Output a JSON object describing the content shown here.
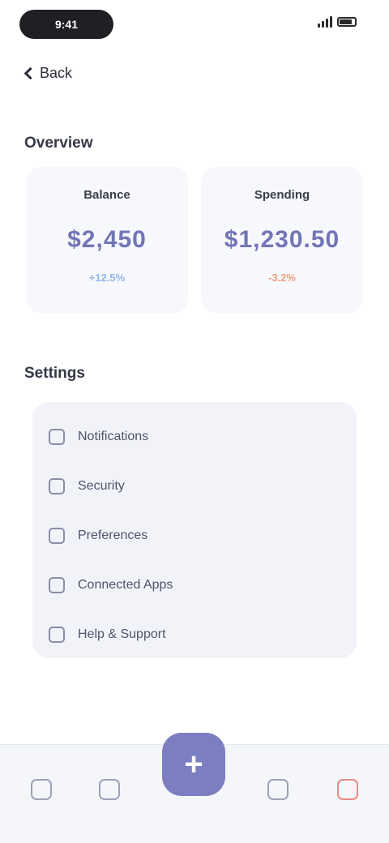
{
  "status_bar": {
    "time": "9:41"
  },
  "header": {
    "back_label": "Back"
  },
  "overview": {
    "title": "Overview",
    "cards": [
      {
        "label": "Balance",
        "value": "$2,450",
        "delta": "+12.5%"
      },
      {
        "label": "Spending",
        "value": "$1,230.50",
        "delta": "-3.2%"
      }
    ]
  },
  "settings": {
    "title": "Settings",
    "items": [
      {
        "label": "Notifications",
        "icon": "bell-icon"
      },
      {
        "label": "Security",
        "icon": "shield-icon"
      },
      {
        "label": "Preferences",
        "icon": "sliders-icon"
      },
      {
        "label": "Connected Apps",
        "icon": "apps-icon"
      },
      {
        "label": "Help & Support",
        "icon": "help-icon"
      }
    ]
  },
  "tabbar": {
    "tabs": [
      "home-icon",
      "chart-icon",
      "add-icon",
      "wallet-icon",
      "alert-icon"
    ]
  },
  "colors": {
    "accent": "#7c7ec2",
    "value": "#7275b6",
    "positive": "#8fb6ea",
    "negative": "#eca07e",
    "alert": "#e88a86"
  }
}
